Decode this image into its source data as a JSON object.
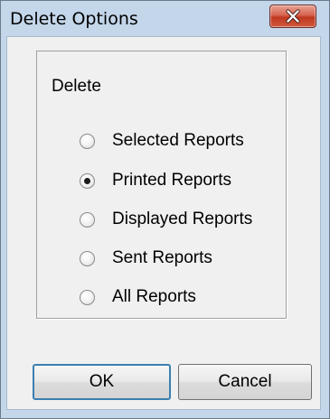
{
  "window": {
    "title": "Delete Options"
  },
  "group": {
    "legend": "Delete",
    "options": [
      {
        "label": "Selected Reports",
        "checked": false
      },
      {
        "label": "Printed Reports",
        "checked": true
      },
      {
        "label": "Displayed Reports",
        "checked": false
      },
      {
        "label": "Sent Reports",
        "checked": false
      },
      {
        "label": "All Reports",
        "checked": false
      }
    ]
  },
  "buttons": {
    "ok_label": "OK",
    "cancel_label": "Cancel"
  },
  "icons": {
    "close": "close-icon",
    "radio_selected": "radio-selected-icon",
    "radio_unselected": "radio-unselected-icon"
  },
  "colors": {
    "title_bar": "#c3d6ea",
    "close_button": "#c0381f",
    "dialog_background": "#f0f0f0",
    "default_button_border": "#3c7fb1"
  }
}
